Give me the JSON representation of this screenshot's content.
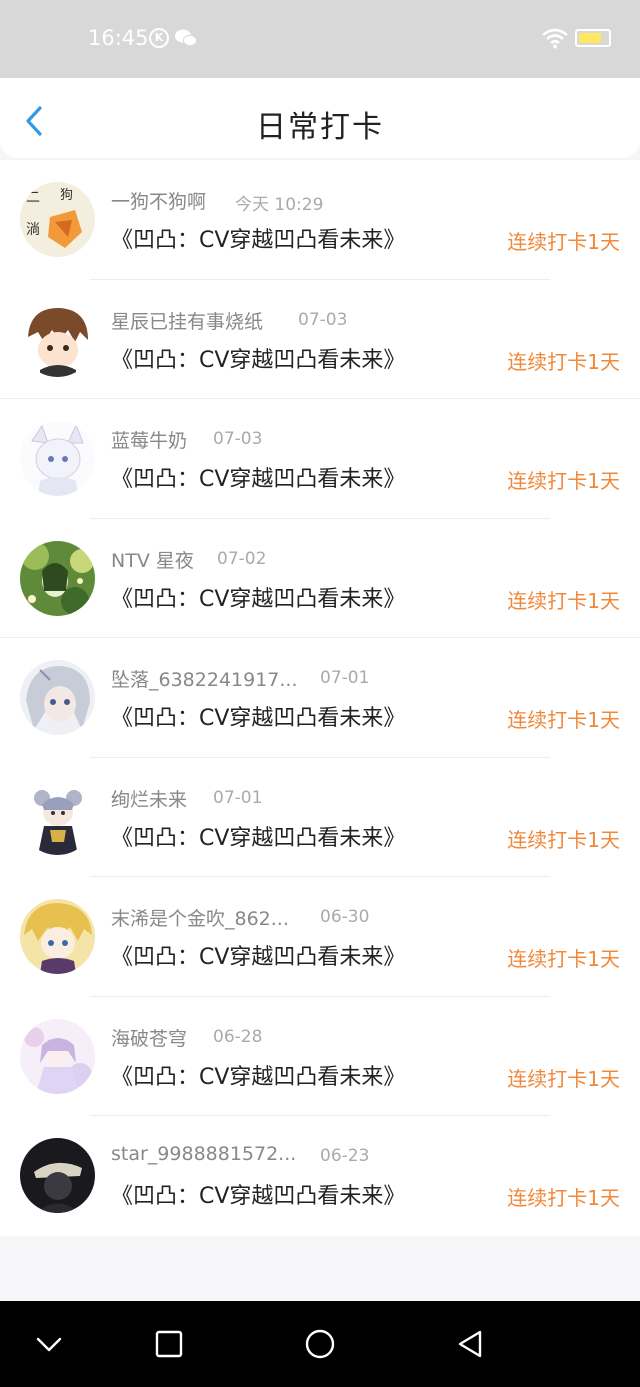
{
  "status_bar": {
    "time": "16:45",
    "icons": [
      "k-icon",
      "wechat-icon",
      "wifi-icon",
      "battery-icon"
    ],
    "battery_level": 0.78
  },
  "header": {
    "title": "日常打卡",
    "back_icon": "chevron-left-icon"
  },
  "entries": [
    {
      "username": "一狗不狗啊",
      "date": "今天 10:29",
      "book": "《凹凸：CV穿越凹凸看未来》",
      "streak": "连续打卡1天"
    },
    {
      "username": "星辰已挂有事烧纸",
      "date": "07-03",
      "book": "《凹凸：CV穿越凹凸看未来》",
      "streak": "连续打卡1天"
    },
    {
      "username": "蓝莓牛奶",
      "date": "07-03",
      "book": "《凹凸：CV穿越凹凸看未来》",
      "streak": "连续打卡1天"
    },
    {
      "username": "NTV 星夜",
      "date": "07-02",
      "book": "《凹凸：CV穿越凹凸看未来》",
      "streak": "连续打卡1天"
    },
    {
      "username": "坠落_6382241917...",
      "date": "07-01",
      "book": "《凹凸：CV穿越凹凸看未来》",
      "streak": "连续打卡1天"
    },
    {
      "username": "绚烂未来",
      "date": "07-01",
      "book": "《凹凸：CV穿越凹凸看未来》",
      "streak": "连续打卡1天"
    },
    {
      "username": "末浠是个金吹_862...",
      "date": "06-30",
      "book": "《凹凸：CV穿越凹凸看未来》",
      "streak": "连续打卡1天"
    },
    {
      "username": "海破苍穹",
      "date": "06-28",
      "book": "《凹凸：CV穿越凹凸看未来》",
      "streak": "连续打卡1天"
    },
    {
      "username": "star_9988881572...",
      "date": "06-23",
      "book": "《凹凸：CV穿越凹凸看未来》",
      "streak": "连续打卡1天"
    }
  ],
  "nav_bar": {
    "buttons": [
      "chevron-down-icon",
      "square-icon",
      "circle-icon",
      "triangle-back-icon"
    ]
  },
  "colors": {
    "accent": "#f0883a",
    "back_icon": "#2f9be8",
    "status_bar": "#d8d8d8",
    "battery": "#ffe760"
  }
}
